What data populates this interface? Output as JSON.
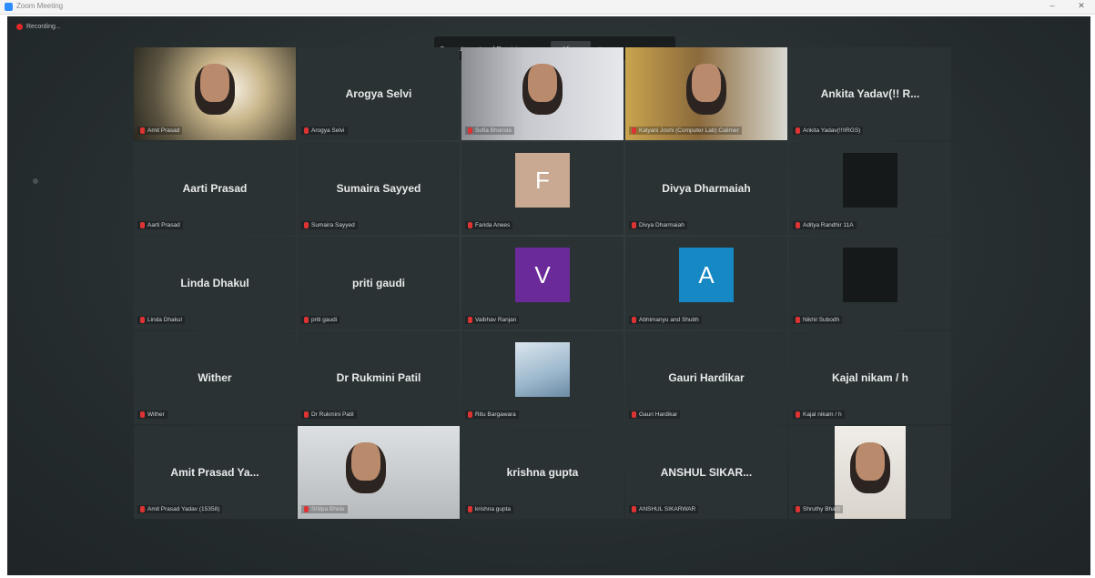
{
  "window": {
    "title": "Zoom Meeting",
    "minimize": "–",
    "close": "✕"
  },
  "recording": {
    "label": "Recording..."
  },
  "banner": {
    "message": "Computer entered Re-sizing zoom",
    "view_button": "View",
    "chevron": "▾"
  },
  "participants": [
    {
      "big": "",
      "small": "Amit Prasad",
      "kind": "video",
      "active": true
    },
    {
      "big": "Arogya Selvi",
      "small": "Arogya Selvi",
      "kind": "name"
    },
    {
      "big": "",
      "small": "Sofia Bhonsle",
      "kind": "video"
    },
    {
      "big": "",
      "small": "Kalyani Joshi (Computer Lab) Calimer",
      "kind": "video"
    },
    {
      "big": "Ankita Yadav(!! R...",
      "small": "Ankita Yadav(!!!IRGS)",
      "kind": "name"
    },
    {
      "big": "Aarti Prasad",
      "small": "Aarti Prasad",
      "kind": "name"
    },
    {
      "big": "Sumaira Sayyed",
      "small": "Sumaira Sayyed",
      "kind": "name"
    },
    {
      "big": "",
      "small": "Farida Anees",
      "kind": "avatar",
      "letter": "F",
      "color": "#c9a992"
    },
    {
      "big": "Divya Dharmaiah",
      "small": "Divya Dharmaiah",
      "kind": "name"
    },
    {
      "big": "",
      "small": "Aditya Randhir 11A",
      "kind": "avatar",
      "letter": "",
      "color": "#15191a"
    },
    {
      "big": "Linda Dhakul",
      "small": "Linda Dhakul",
      "kind": "name"
    },
    {
      "big": "priti gaudi",
      "small": "priti gaudi",
      "kind": "name"
    },
    {
      "big": "",
      "small": "Vaibhav Ranjan",
      "kind": "avatar",
      "letter": "V",
      "color": "#6b2a9a"
    },
    {
      "big": "",
      "small": "Abhimanyu and Shubh",
      "kind": "avatar",
      "letter": "A",
      "color": "#1688c4"
    },
    {
      "big": "",
      "small": "Nikhil Subodh",
      "kind": "avatar",
      "letter": "",
      "color": "#15191a"
    },
    {
      "big": "Wither",
      "small": "Wither",
      "kind": "name"
    },
    {
      "big": "Dr Rukmini Patil",
      "small": "Dr Rukmini Patil",
      "kind": "name"
    },
    {
      "big": "",
      "small": "Ritu Bargawara",
      "kind": "photo"
    },
    {
      "big": "Gauri Hardikar",
      "small": "Gauri Hardikar",
      "kind": "name"
    },
    {
      "big": "Kajal nikam / h",
      "small": "Kajal nikam / h",
      "kind": "name"
    },
    {
      "big": "Amit Prasad Ya...",
      "small": "Amit Prasad Yadav (15358)",
      "kind": "name"
    },
    {
      "big": "",
      "small": "Shilpa Bhide",
      "kind": "video"
    },
    {
      "big": "krishna gupta",
      "small": "krishna gupta",
      "kind": "name"
    },
    {
      "big": "ANSHUL SIKAR...",
      "small": "ANSHUL SIKARWAR",
      "kind": "name"
    },
    {
      "big": "",
      "small": "Shruthy Bharti",
      "kind": "video"
    }
  ]
}
